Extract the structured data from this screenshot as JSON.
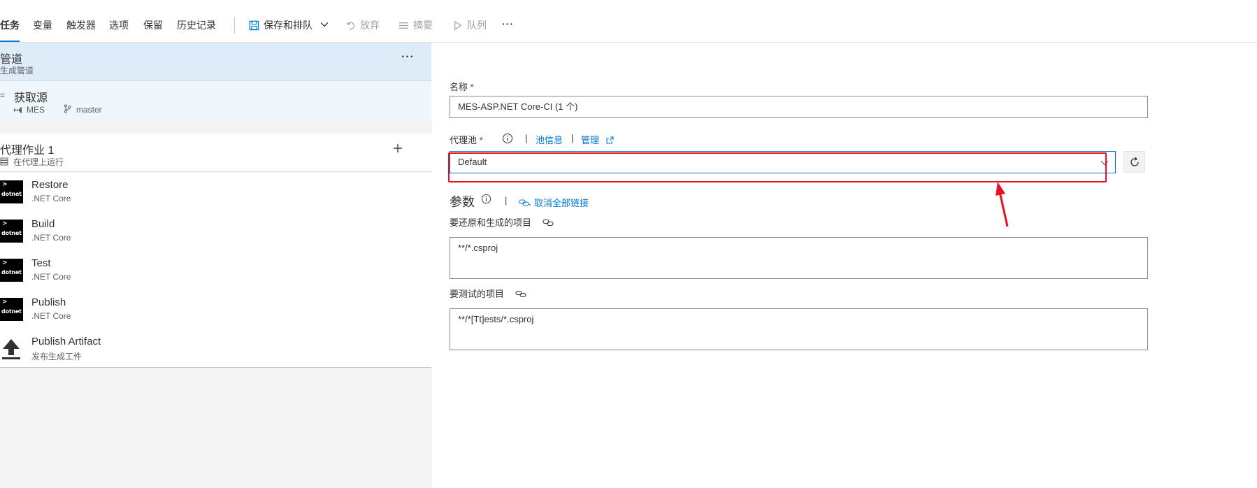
{
  "toolbar": {
    "tabs": [
      "任务",
      "变量",
      "触发器",
      "选项",
      "保留",
      "历史记录"
    ],
    "save_queue": "保存和排队",
    "discard": "放弃",
    "summary": "摘要",
    "queue": "队列",
    "more": "···"
  },
  "pipeline": {
    "title": "管道",
    "subtitle": "生成管道",
    "more": "···"
  },
  "source": {
    "title": "获取源",
    "repo": "MES",
    "branch": "master"
  },
  "job": {
    "title": "代理作业 1",
    "subtitle": "在代理上运行",
    "add": "+"
  },
  "tasks": [
    {
      "name": "Restore",
      "sub": ".NET Core",
      "icon": "dotnet"
    },
    {
      "name": "Build",
      "sub": ".NET Core",
      "icon": "dotnet"
    },
    {
      "name": "Test",
      "sub": ".NET Core",
      "icon": "dotnet"
    },
    {
      "name": "Publish",
      "sub": ".NET Core",
      "icon": "dotnet"
    },
    {
      "name": "Publish Artifact",
      "sub": "发布生成工件",
      "icon": "upload-icon"
    }
  ],
  "details": {
    "name_label": "名称",
    "required_mark": "*",
    "name_value": "MES-ASP.NET Core-CI (1 个)",
    "agent_pool_label": "代理池",
    "pool_info": "池信息",
    "manage": "管理",
    "pool_value": "Default",
    "params_label": "参数",
    "unlink_all": "取消全部链接",
    "restore_projects_label": "要还原和生成的项目",
    "restore_projects_value": "**/*.csproj",
    "test_projects_label": "要测试的项目",
    "test_projects_value": "**/*[Tt]ests/*.csproj"
  },
  "colors": {
    "accent": "#0078d4",
    "selected_bg": "#deecf9",
    "annotation_red": "#e81123"
  }
}
